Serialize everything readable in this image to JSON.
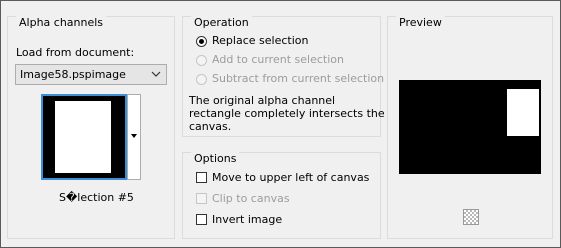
{
  "alpha": {
    "title": "Alpha channels",
    "load_label": "Load from document:",
    "selected_doc": "Image58.pspimage",
    "selection_name": "S�lection #5"
  },
  "operation": {
    "title": "Operation",
    "options": [
      {
        "label": "Replace selection",
        "checked": true,
        "enabled": true
      },
      {
        "label": "Add to current selection",
        "checked": false,
        "enabled": false
      },
      {
        "label": "Subtract from current selection",
        "checked": false,
        "enabled": false
      }
    ],
    "message_line1": "The original alpha channel",
    "message_line2": "rectangle completely intersects the",
    "message_line3": "canvas."
  },
  "options": {
    "title": "Options",
    "items": [
      {
        "label": "Move to upper left of canvas",
        "checked": false,
        "enabled": true
      },
      {
        "label": "Clip to canvas",
        "checked": false,
        "enabled": false
      },
      {
        "label": "Invert image",
        "checked": false,
        "enabled": true
      }
    ]
  },
  "preview": {
    "title": "Preview"
  }
}
